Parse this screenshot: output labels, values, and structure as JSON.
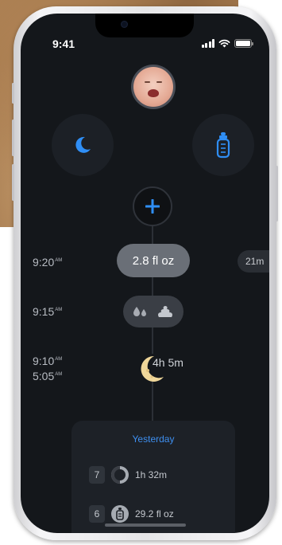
{
  "status_bar": {
    "time": "9:41",
    "icons": [
      "cellular-signal-icon",
      "wifi-icon",
      "battery-icon"
    ]
  },
  "profile": {
    "avatar": "baby-photo-avatar"
  },
  "quick_actions": [
    {
      "name": "sleep",
      "icon": "moon-icon"
    },
    {
      "name": "feeding",
      "icon": "bottle-icon"
    }
  ],
  "add_button": {
    "icon": "plus-icon"
  },
  "timeline": {
    "entries": [
      {
        "time": "9:20",
        "ampm": "AM",
        "value": "2.8 fl oz",
        "side_value": "21m"
      },
      {
        "time": "9:15",
        "ampm": "AM",
        "icons": [
          "wet-diaper-icon",
          "poop-icon"
        ]
      },
      {
        "time_start": "9:10",
        "time_end": "5:05",
        "ampm": "AM",
        "value": "4h 5m",
        "icon": "crescent-moon-icon"
      }
    ]
  },
  "summary_card": {
    "title": "Yesterday",
    "rows": [
      {
        "count": "7",
        "icon": "sleep-clock-icon",
        "value": "1h 32m"
      },
      {
        "count": "6",
        "icon": "bottle-icon",
        "value": "29.2 fl oz"
      }
    ]
  },
  "colors": {
    "accent": "#3e8ff0",
    "screen_bg": "#14171b",
    "moon": "#f0d79a"
  }
}
